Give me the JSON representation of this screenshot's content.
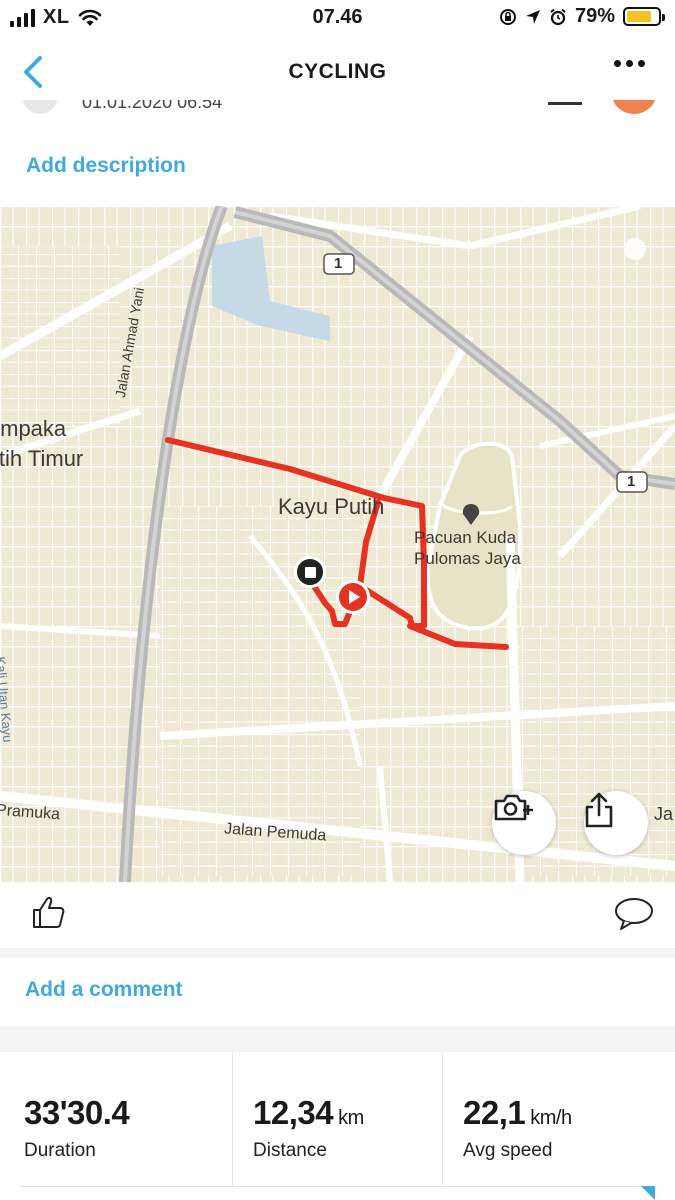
{
  "status_bar": {
    "carrier": "XL",
    "time": "07.46",
    "battery_percent": "79%",
    "battery_level": 0.79,
    "icons": [
      "signal-icon",
      "wifi-icon",
      "orientation-lock-icon",
      "location-icon",
      "alarm-icon",
      "battery-icon"
    ]
  },
  "nav": {
    "title": "CYCLING",
    "back_icon": "chevron-left-icon",
    "more_icon": "more-dots-icon"
  },
  "activity": {
    "date_partial": "01.01.2020 06:54",
    "add_description": "Add description"
  },
  "map": {
    "labels": {
      "cempaka": "Cempaka",
      "putih_timur": "Putih Timur",
      "kayu_putih": "Kayu Putih",
      "pacuan_line1": "Pacuan Kuda",
      "pacuan_line2": "Pulomas Jaya",
      "jalan_ahmad_yani": "Jalan Ahmad Yani",
      "kali_utan_kayu": "Kali Utan Kayu",
      "pramuka": "Pramuka",
      "jalan_pemuda": "Jalan Pemuda",
      "ja": "Ja",
      "route_1a": "1",
      "route_1b": "1"
    },
    "route_color": "#e53222",
    "road_color": "#ffffff",
    "highway_color": "#b9b9b9",
    "water_color": "#c5d9e6",
    "park_color": "#e3e6c8",
    "buttons": {
      "camera": "camera-add-icon",
      "share": "share-icon"
    }
  },
  "actions": {
    "like_icon": "thumbs-up-icon",
    "comment_icon": "comment-bubble-icon",
    "add_comment": "Add a comment"
  },
  "stats": [
    {
      "value": "33'30.4",
      "unit": "",
      "label": "Duration"
    },
    {
      "value": "12,34",
      "unit": "km",
      "label": "Distance"
    },
    {
      "value": "22,1",
      "unit": "km/h",
      "label": "Avg speed"
    }
  ],
  "accent_color": "#3fa9e0"
}
